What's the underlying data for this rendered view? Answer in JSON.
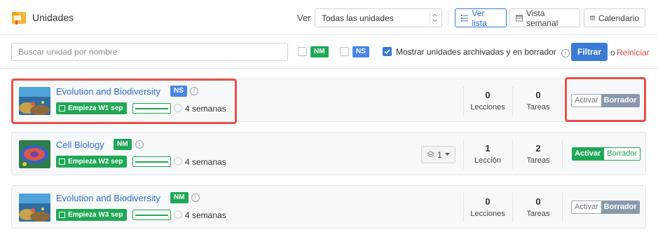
{
  "header": {
    "title": "Unidades",
    "ver_label": "Ver",
    "view_select": "Todas las unidades",
    "views": [
      {
        "label": "Ver lista",
        "icon": "list-icon",
        "active": true
      },
      {
        "label": "Vista semanal",
        "icon": "calendar-week-icon",
        "active": false
      },
      {
        "label": "Calendario",
        "icon": "calendar-icon",
        "active": false
      }
    ]
  },
  "filters": {
    "search_placeholder": "Buscar unidad por nombre",
    "nm_label": "NM",
    "nm_checked": false,
    "ns_label": "NS",
    "ns_checked": false,
    "archived_checked": true,
    "archived_label": "Mostrar unidades archivadas y en borrador",
    "filter_button": "Filtrar",
    "or_text": "o",
    "reset_link": "Reiniciar"
  },
  "units": [
    {
      "name": "Evolution and Biodiversity",
      "level": "NS",
      "level_color": "#4a86e8",
      "start": "Empieza W1 sep",
      "duration": "4 semanas",
      "lessons": "0",
      "lessons_label": "Lecciones",
      "tasks": "0",
      "tasks_label": "Tareas",
      "activate_label": "Activar",
      "draft_label": "Borrador",
      "active": false
    },
    {
      "name": "Cell Biology",
      "level": "NM",
      "level_color": "#1fa855",
      "start": "Empieza W2 sep",
      "duration": "4 semanas",
      "levels_count": "1",
      "lessons": "1",
      "lessons_label": "Lección",
      "tasks": "2",
      "tasks_label": "Tareas",
      "activate_label": "Activar",
      "draft_label": "Borrador",
      "active": true
    },
    {
      "name": "Evolution and Biodiversity",
      "level": "NM",
      "level_color": "#1fa855",
      "start": "Empieza W3 sep",
      "duration": "4 semanas",
      "lessons": "0",
      "lessons_label": "Lecciones",
      "tasks": "0",
      "tasks_label": "Tareas",
      "activate_label": "Activar",
      "draft_label": "Borrador",
      "active": false
    }
  ],
  "colors": {
    "primary": "#3a7bd5",
    "success": "#1fa855",
    "highlight": "#e8504a",
    "reset": "#e04b4b"
  }
}
